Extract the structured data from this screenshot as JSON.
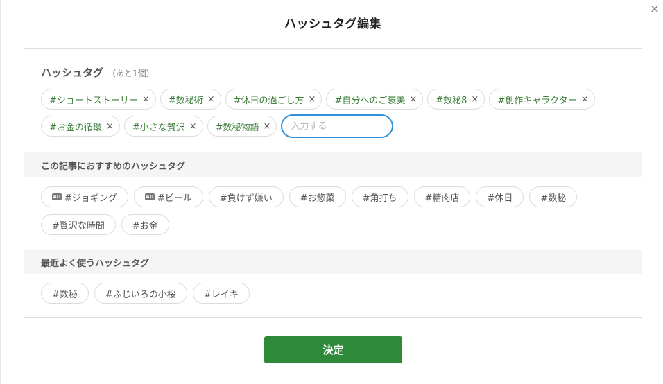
{
  "modal": {
    "title": "ハッシュタグ編集",
    "close_glyph": "×",
    "confirm_label": "決定"
  },
  "hashtags": {
    "title": "ハッシュタグ",
    "remaining": "（あと1個）",
    "remove_glyph": "×",
    "selected": [
      "#ショートストーリー",
      "#数秘術",
      "#休日の過ごし方",
      "#自分へのご褒美",
      "#数秘8",
      "#創作キャラクター",
      "#お金の循環",
      "#小さな贅沢",
      "#数秘物語"
    ],
    "input_placeholder": "入力する"
  },
  "recommended": {
    "title": "この記事におすすめのハッシュタグ",
    "ad_icon_label": "AD",
    "tags": [
      "#ジョギング",
      "#ビール",
      "#負けず嫌い",
      "#お惣菜",
      "#角打ち",
      "#精肉店",
      "#休日",
      "#数秘",
      "#贅沢な時間",
      "#お金"
    ]
  },
  "recent": {
    "title": "最近よく使うハッシュタグ",
    "tags": [
      "#数秘",
      "#ふじいろの小桜",
      "#レイキ"
    ]
  },
  "colors": {
    "accent_green": "#2d8a38",
    "tag_text_green": "#3a7d3a",
    "focus_blue": "#2f8fd8"
  }
}
